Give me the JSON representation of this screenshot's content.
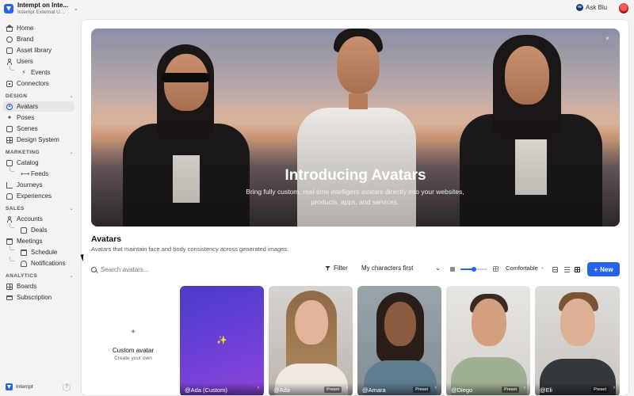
{
  "org": {
    "name": "Intempt on Inte...",
    "subtitle": "Intempt External U..."
  },
  "topbar": {
    "ask_label": "Ask Blu"
  },
  "sidebar": {
    "items": [
      {
        "label": "Home"
      },
      {
        "label": "Brand"
      },
      {
        "label": "Asset library"
      },
      {
        "label": "Users"
      },
      {
        "label": "Events"
      },
      {
        "label": "Connectors"
      }
    ],
    "design": {
      "title": "DESIGN",
      "items": [
        {
          "label": "Avatars"
        },
        {
          "label": "Poses"
        },
        {
          "label": "Scenes"
        },
        {
          "label": "Design System"
        }
      ]
    },
    "marketing": {
      "title": "MARKETING",
      "items": [
        {
          "label": "Catalog"
        },
        {
          "label": "Feeds"
        },
        {
          "label": "Journeys"
        },
        {
          "label": "Experiences"
        }
      ]
    },
    "sales": {
      "title": "SALES",
      "items": [
        {
          "label": "Accounts"
        },
        {
          "label": "Deals"
        },
        {
          "label": "Meetings"
        },
        {
          "label": "Schedule"
        },
        {
          "label": "Notifications"
        }
      ]
    },
    "analytics": {
      "title": "ANALYTICS",
      "items": [
        {
          "label": "Boards"
        },
        {
          "label": "Subscription"
        }
      ]
    },
    "footer": {
      "label": "Intempt",
      "help": "?"
    }
  },
  "hero": {
    "title": "Introducing Avatars",
    "subtitle": "Bring fully custom, real-time intelligent avatars directly into your websites, products, apps, and services.",
    "close": "×"
  },
  "section": {
    "title": "Avatars",
    "subtitle": "Avatars that maintain face and body consistency across generated images."
  },
  "toolbar": {
    "search_placeholder": "Search avatars...",
    "filter_label": "Filter",
    "sort_value": "My characters first",
    "sort_chevron": "⌄",
    "density_value": "Comfortable",
    "density_chevron": "⌄",
    "slider_value": 0.5,
    "new_label": "New",
    "new_icon": "+"
  },
  "cards": {
    "custom": {
      "plus": "+",
      "title": "Custom avatar",
      "subtitle": "Create your own"
    },
    "items": [
      {
        "label": "@Ada (Custom)",
        "badge": "",
        "arrow": "›",
        "icon": "sparkle-icon",
        "bg": "#5b3fd0"
      },
      {
        "label": "@Ada",
        "badge": "Preset",
        "arrow": "›"
      },
      {
        "label": "@Amara",
        "badge": "Preset",
        "arrow": "›"
      },
      {
        "label": "@Diego",
        "badge": "Preset",
        "arrow": "›"
      },
      {
        "label": "@Eli",
        "badge": "Preset",
        "arrow": "›"
      }
    ]
  },
  "colors": {
    "accent": "#2563eb",
    "active_nav": "#1d4ed8"
  }
}
